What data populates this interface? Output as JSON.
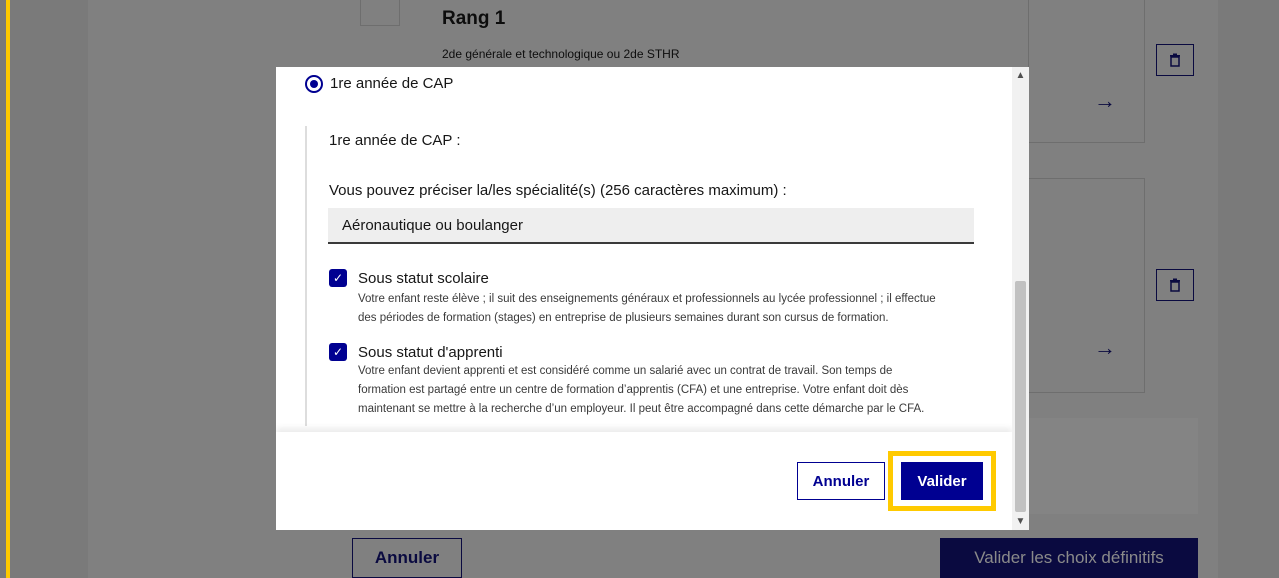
{
  "background": {
    "rank_title": "Rang 1",
    "rank_subtitle": "2de générale et technologique ou 2de STHR",
    "cancel_label": "Annuler",
    "final_validate_label": "Valider les choix définitifs"
  },
  "modal": {
    "option_label": "1re année de CAP",
    "subsection_title": "1re année de CAP :",
    "specialty_label": "Vous pouvez préciser la/les spécialité(s) (256 caractères maximum) :",
    "specialty_value": "Aéronautique ou boulanger",
    "checkbox_school": {
      "label": "Sous statut scolaire",
      "hint_line1": "Votre enfant reste élève ; il suit des enseignements généraux et professionnels au lycée professionnel ; il effectue",
      "hint_line2": "des périodes de formation (stages) en entreprise de plusieurs semaines durant son cursus de formation.",
      "checked": true
    },
    "checkbox_apprentice": {
      "label": "Sous statut d'apprenti",
      "hint_line1": "Votre enfant devient apprenti et est considéré comme un salarié avec un contrat de travail. Son temps de",
      "hint_line2": "formation est partagé entre un centre de formation d’apprentis (CFA) et une entreprise. Votre enfant doit dès",
      "hint_line3": "maintenant se mettre à la recherche d’un employeur. Il peut être accompagné dans cette démarche par le CFA.",
      "checked": true
    },
    "cancel_label": "Annuler",
    "validate_label": "Valider"
  },
  "colors": {
    "primary": "#000091",
    "focus": "#ffca00",
    "overlay": "#7a7a7a"
  },
  "icons": {
    "arrow": "arrow-right-icon",
    "trash": "trash-icon",
    "check": "check-icon"
  }
}
